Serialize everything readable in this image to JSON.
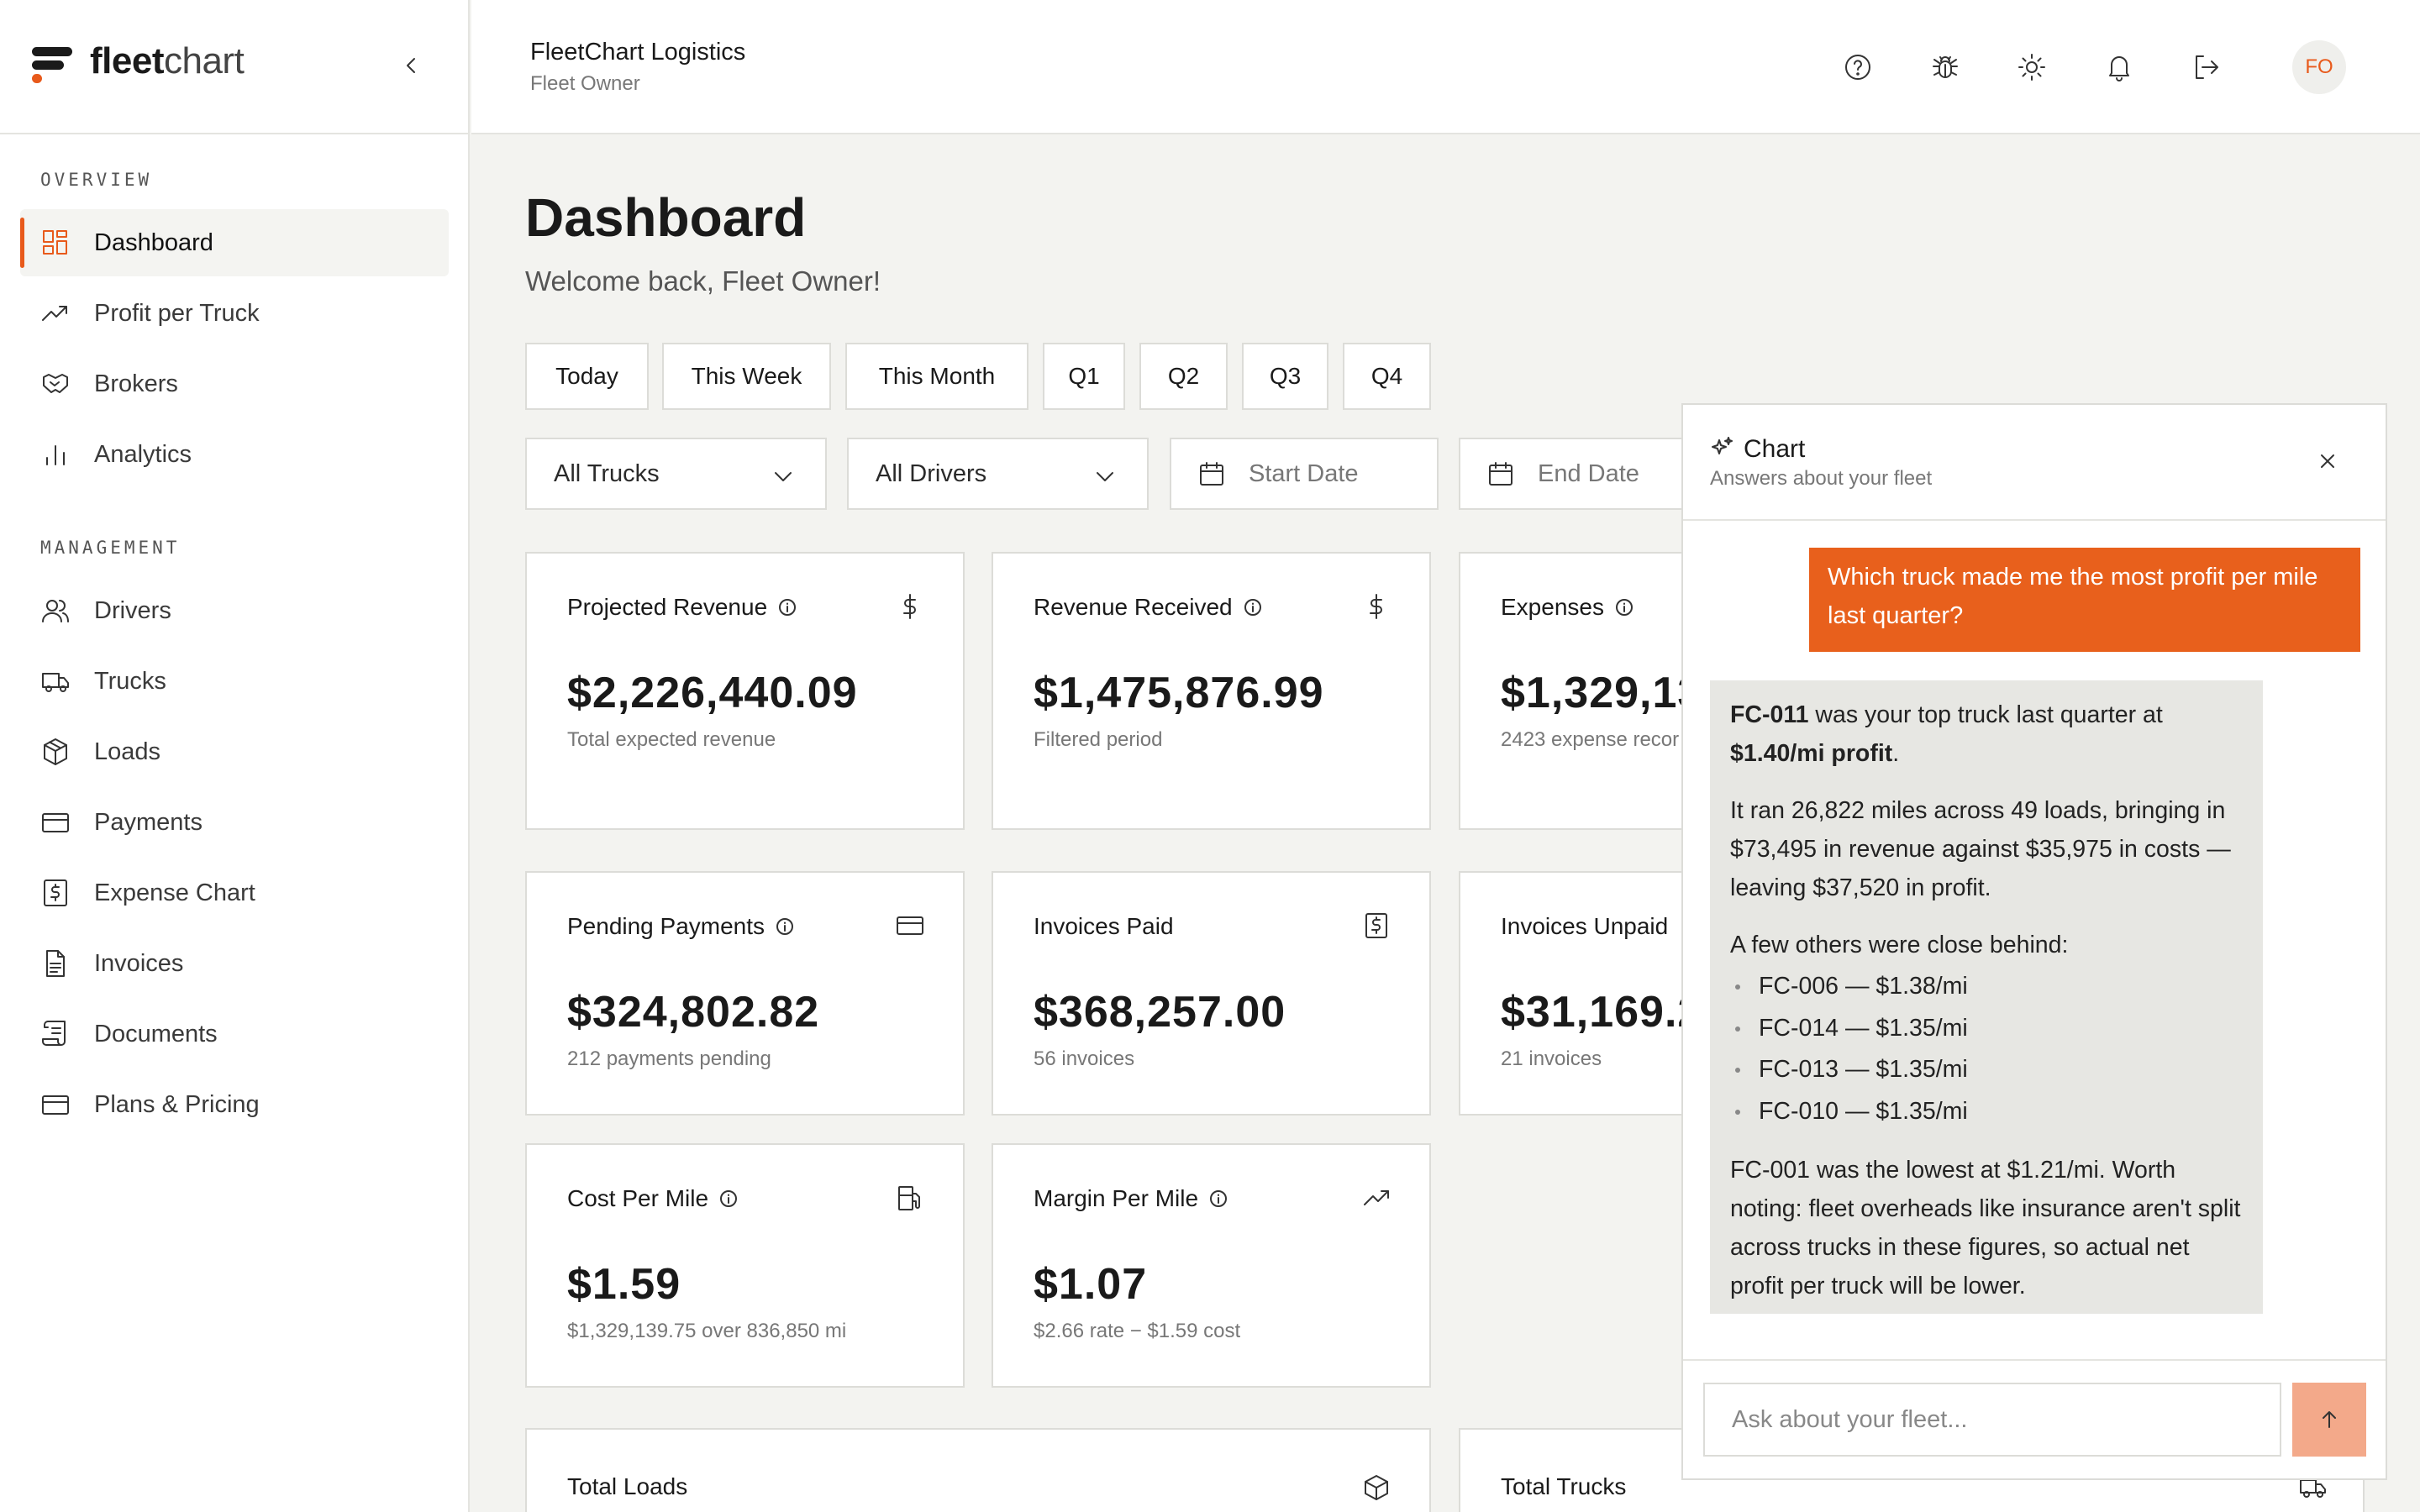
{
  "brand": {
    "name_bold": "fleet",
    "name_light": "chart",
    "accent": "#E85A1B"
  },
  "sidebar": {
    "sections": [
      {
        "label": "OVERVIEW",
        "items": [
          {
            "label": "Dashboard",
            "icon": "dashboard-icon",
            "active": true
          },
          {
            "label": "Profit per Truck",
            "icon": "trending-up-icon"
          },
          {
            "label": "Brokers",
            "icon": "handshake-icon"
          },
          {
            "label": "Analytics",
            "icon": "bar-chart-icon"
          }
        ]
      },
      {
        "label": "MANAGEMENT",
        "items": [
          {
            "label": "Drivers",
            "icon": "users-icon"
          },
          {
            "label": "Trucks",
            "icon": "truck-icon"
          },
          {
            "label": "Loads",
            "icon": "package-icon"
          },
          {
            "label": "Payments",
            "icon": "credit-card-icon"
          },
          {
            "label": "Expense Chart",
            "icon": "receipt-icon"
          },
          {
            "label": "Invoices",
            "icon": "file-text-icon"
          },
          {
            "label": "Documents",
            "icon": "scroll-icon"
          },
          {
            "label": "Plans & Pricing",
            "icon": "credit-card-icon"
          }
        ]
      }
    ]
  },
  "header": {
    "company": "FleetChart Logistics",
    "role": "Fleet Owner",
    "avatar_initials": "FO"
  },
  "main": {
    "title": "Dashboard",
    "welcome": "Welcome back, Fleet Owner!",
    "periods": [
      "Today",
      "This Week",
      "This Month",
      "Q1",
      "Q2",
      "Q3",
      "Q4"
    ],
    "filters": {
      "trucks": "All Trucks",
      "drivers": "All Drivers",
      "start_date": "Start Date",
      "end_date": "End Date"
    },
    "cards": [
      {
        "title": "Projected Revenue",
        "value": "$2,226,440.09",
        "sub": "Total expected revenue"
      },
      {
        "title": "Revenue Received",
        "value": "$1,475,876.99",
        "sub": "Filtered period"
      },
      {
        "title": "Expenses",
        "value": "$1,329,13",
        "sub": "2423 expense recor"
      },
      {
        "title": "Pending Payments",
        "value": "$324,802.82",
        "sub": "212 payments pending"
      },
      {
        "title": "Invoices Paid",
        "value": "$368,257.00",
        "sub": "56 invoices"
      },
      {
        "title": "Invoices Unpaid",
        "value": "$31,169.2",
        "sub": "21 invoices"
      },
      {
        "title": "Cost Per Mile",
        "value": "$1.59",
        "sub": "$1,329,139.75 over 836,850 mi"
      },
      {
        "title": "Margin Per Mile",
        "value": "$1.07",
        "sub": "$2.66 rate − $1.59 cost"
      },
      {
        "title": "Total Loads"
      },
      {
        "title": "Total Trucks"
      }
    ]
  },
  "chat": {
    "title": "Chart",
    "subtitle": "Answers about your fleet",
    "user_message": "Which truck made me the most profit per mile last quarter?",
    "bot": {
      "p1_truck": "FC-011",
      "p1_mid": " was your top truck last quarter at ",
      "p1_profit": "$1.40/mi profit",
      "p1_end": ".",
      "p2": "It ran 26,822 miles across 49 loads, bringing in $73,495 in revenue against $35,975 in costs — leaving $37,520 in profit.",
      "p3": "A few others were close behind:",
      "list": [
        "FC-006 — $1.38/mi",
        "FC-014 — $1.35/mi",
        "FC-013 — $1.35/mi",
        "FC-010 — $1.35/mi"
      ],
      "p4": "FC-001 was the lowest at $1.21/mi. Worth noting: fleet overheads like insurance aren't split across trucks in these figures, so actual net profit per truck will be lower."
    },
    "input_placeholder": "Ask about your fleet..."
  }
}
